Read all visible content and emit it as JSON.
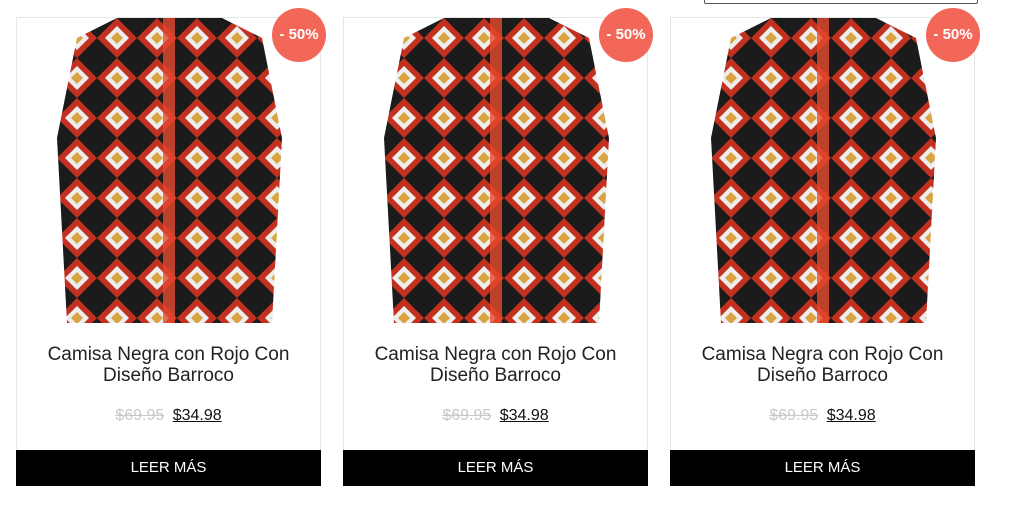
{
  "products": [
    {
      "title": "Camisa Negra con Rojo Con Diseño Barroco",
      "discount": "- 50%",
      "old_price": "$69.95",
      "new_price": "$34.98",
      "button": "LEER MÁS"
    },
    {
      "title": "Camisa Negra con Rojo Con Diseño Barroco",
      "discount": "- 50%",
      "old_price": "$69.95",
      "new_price": "$34.98",
      "button": "LEER MÁS"
    },
    {
      "title": "Camisa Negra con Rojo Con Diseño Barroco",
      "discount": "- 50%",
      "old_price": "$69.95",
      "new_price": "$34.98",
      "button": "LEER MÁS"
    }
  ],
  "colors": {
    "badge": "#f26757",
    "button": "#000000"
  }
}
